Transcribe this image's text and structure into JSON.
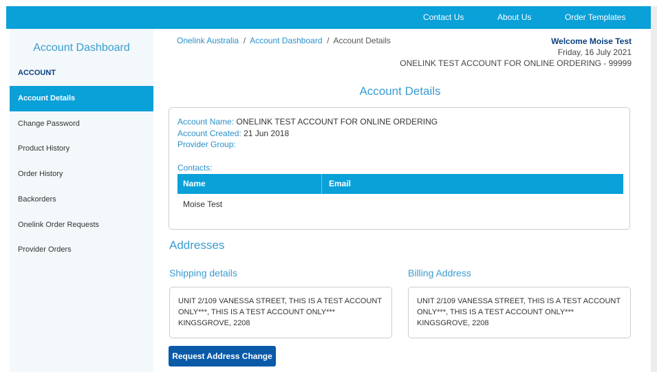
{
  "topnav": {
    "contact": "Contact Us",
    "about": "About Us",
    "templates": "Order Templates"
  },
  "sidebar": {
    "title": "Account Dashboard",
    "section": "ACCOUNT",
    "items": [
      {
        "label": "Account Details",
        "active": true
      },
      {
        "label": "Change Password"
      },
      {
        "label": "Product History"
      },
      {
        "label": "Order History"
      },
      {
        "label": "Backorders"
      },
      {
        "label": "Onelink Order Requests"
      },
      {
        "label": "Provider Orders"
      }
    ]
  },
  "breadcrumb": {
    "home": "Onelink Australia",
    "dashboard": "Account Dashboard",
    "current": "Account Details",
    "sep": "/"
  },
  "welcome": {
    "line1": "Welcome Moise Test",
    "date": "Friday, 16 July 2021",
    "account": "ONELINK TEST ACCOUNT FOR ONLINE ORDERING - 99999"
  },
  "details": {
    "heading": "Account Details",
    "account_name_label": "Account Name:",
    "account_name": "ONELINK TEST ACCOUNT FOR ONLINE ORDERING",
    "account_created_label": "Account Created:",
    "account_created": "21 Jun 2018",
    "provider_group_label": "Provider Group:",
    "provider_group": "",
    "contacts_label": "Contacts:",
    "columns": [
      "Name",
      "Email"
    ],
    "rows": [
      {
        "name": "Moise Test",
        "email": ""
      }
    ]
  },
  "addresses": {
    "heading": "Addresses",
    "shipping": {
      "title": "Shipping details",
      "line1": "UNIT 2/109 VANESSA STREET, THIS IS A TEST ACCOUNT",
      "line2": "ONLY***, THIS IS A TEST ACCOUNT ONLY***",
      "line3": "KINGSGROVE, 2208"
    },
    "billing": {
      "title": "Billing Address",
      "line1": "UNIT 2/109 VANESSA STREET, THIS IS A TEST ACCOUNT",
      "line2": "ONLY***, THIS IS A TEST ACCOUNT ONLY***",
      "line3": "KINGSGROVE, 2208"
    },
    "button": "Request Address Change"
  }
}
